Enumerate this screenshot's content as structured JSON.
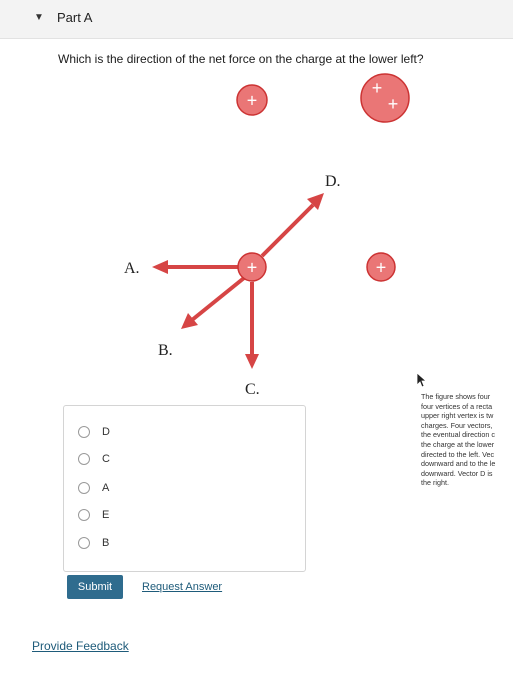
{
  "part": {
    "toggle_icon": "triangle-down-icon",
    "title": "Part A"
  },
  "question": {
    "text": "Which is the direction of the net force on the charge at the lower left?"
  },
  "figure": {
    "charges": [
      {
        "id": "top-middle",
        "symbol": "+"
      },
      {
        "id": "top-right",
        "symbol_top": "+",
        "symbol_bottom": "+"
      },
      {
        "id": "lower-left",
        "symbol": "+"
      },
      {
        "id": "lower-right",
        "symbol": "+"
      }
    ],
    "vector_labels": {
      "a": "A.",
      "b": "B.",
      "c": "C.",
      "d": "D."
    },
    "arrow_color": "#d64545",
    "charge_color": "#ea7676"
  },
  "answer_options": [
    {
      "label": "D",
      "selected": false
    },
    {
      "label": "C",
      "selected": false
    },
    {
      "label": "A",
      "selected": false
    },
    {
      "label": "E",
      "selected": false
    },
    {
      "label": "B",
      "selected": false
    }
  ],
  "actions": {
    "submit_label": "Submit",
    "request_answer_label": "Request Answer",
    "provide_feedback_label": "Provide Feedback"
  },
  "description": {
    "lines": [
      "The figure shows four",
      "four vertices of a recta",
      "upper right vertex is tw",
      "charges. Four vectors,",
      "the eventual direction c",
      "the charge at the lower",
      "directed to the left. Vec",
      "downward and to the le",
      "downward. Vector D is",
      "the right."
    ]
  },
  "colors": {
    "submit_bg": "#2f6c8e",
    "link": "#1e5b7a"
  }
}
